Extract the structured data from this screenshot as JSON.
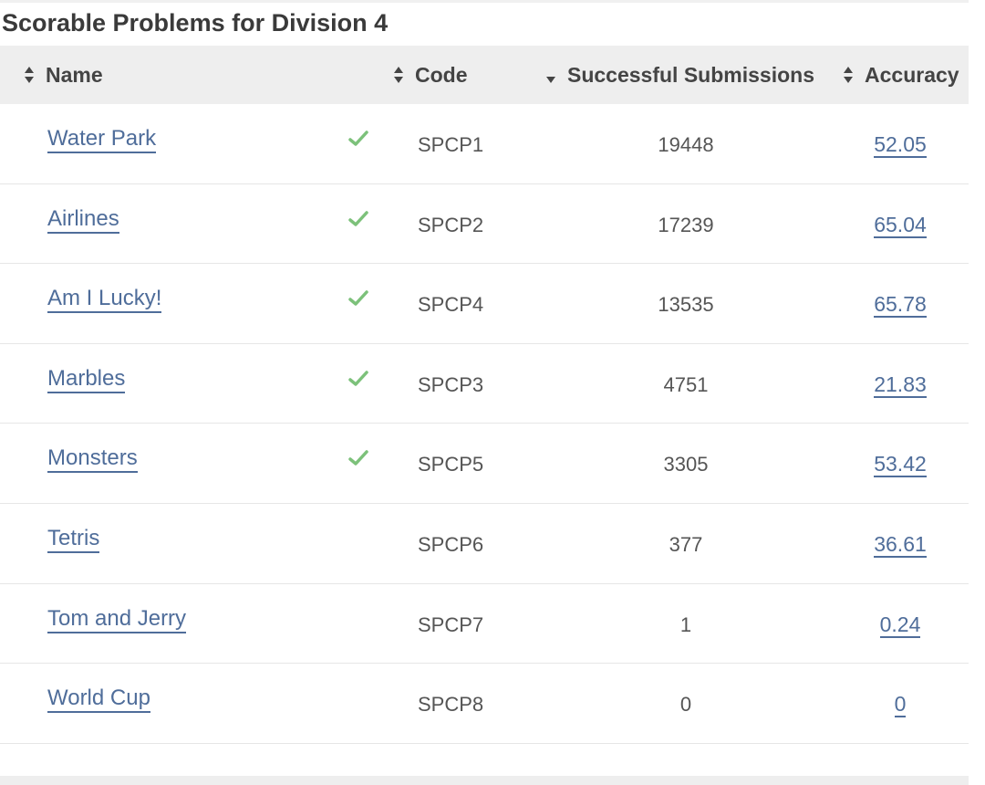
{
  "title": "Scorable Problems for Division 4",
  "columns": {
    "name": "Name",
    "code": "Code",
    "submissions": "Successful Submissions",
    "accuracy": "Accuracy"
  },
  "colors": {
    "link": "#4f6d9a",
    "check": "#7cc17a",
    "header_bg": "#eeeeee"
  },
  "rows": [
    {
      "name": "Water Park",
      "solved": true,
      "code": "SPCP1",
      "submissions": "19448",
      "accuracy": "52.05"
    },
    {
      "name": "Airlines",
      "solved": true,
      "code": "SPCP2",
      "submissions": "17239",
      "accuracy": "65.04"
    },
    {
      "name": "Am I Lucky!",
      "solved": true,
      "code": "SPCP4",
      "submissions": "13535",
      "accuracy": "65.78"
    },
    {
      "name": "Marbles",
      "solved": true,
      "code": "SPCP3",
      "submissions": "4751",
      "accuracy": "21.83"
    },
    {
      "name": "Monsters",
      "solved": true,
      "code": "SPCP5",
      "submissions": "3305",
      "accuracy": "53.42"
    },
    {
      "name": "Tetris",
      "solved": false,
      "code": "SPCP6",
      "submissions": "377",
      "accuracy": "36.61"
    },
    {
      "name": "Tom and Jerry",
      "solved": false,
      "code": "SPCP7",
      "submissions": "1",
      "accuracy": "0.24"
    },
    {
      "name": "World Cup",
      "solved": false,
      "code": "SPCP8",
      "submissions": "0",
      "accuracy": "0"
    }
  ]
}
